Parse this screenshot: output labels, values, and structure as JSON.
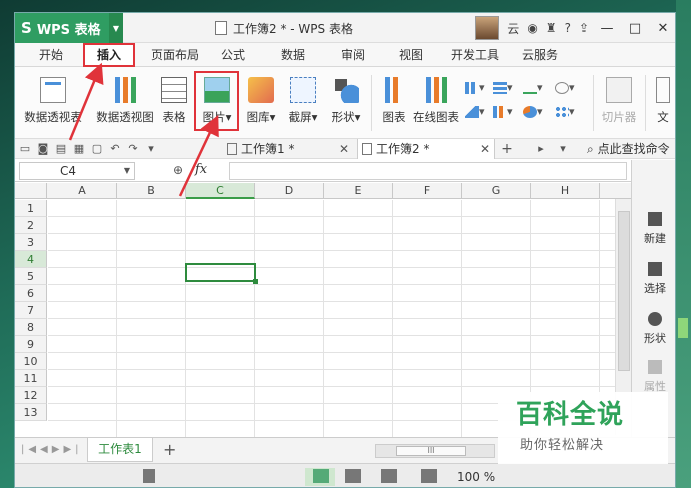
{
  "app": {
    "name": "WPS 表格",
    "doc_title": "工作簿2 * - WPS 表格",
    "user_initial": "云"
  },
  "window_controls": [
    "—",
    "□",
    "✕"
  ],
  "menu": [
    "开始",
    "插入",
    "页面布局",
    "公式",
    "数据",
    "审阅",
    "视图",
    "开发工具",
    "云服务"
  ],
  "active_menu": "插入",
  "ribbon": {
    "pivot_table": "数据透视表",
    "pivot_chart": "数据透视图",
    "table": "表格",
    "picture": "图片",
    "gallery": "图库",
    "screenshot": "截屏",
    "shape": "形状",
    "chart": "图表",
    "online_chart": "在线图表",
    "slicer": "切片器",
    "text": "文"
  },
  "doc_tabs": [
    {
      "label": "工作簿1 *"
    },
    {
      "label": "工作簿2 *"
    }
  ],
  "find_label": "点此查找命令",
  "formula_bar": {
    "name_box": "C4",
    "fx": "fx",
    "value": ""
  },
  "columns": [
    "A",
    "B",
    "C",
    "D",
    "E",
    "F",
    "G",
    "H"
  ],
  "rows": [
    "1",
    "2",
    "3",
    "4",
    "5",
    "6",
    "7",
    "8",
    "9",
    "10",
    "11",
    "12",
    "13"
  ],
  "selected_cell": "C4",
  "task_pane": {
    "new": "新建",
    "select": "选择",
    "shape": "形状",
    "property": "属性"
  },
  "sheet_tab": "工作表1",
  "add_sheet": "+",
  "hscroll_thumb": "III",
  "zoom_label": "100 %",
  "watermark": {
    "top": "百科全说",
    "bottom": "助你轻松解决"
  },
  "colors": {
    "accent_green": "#2f9d62",
    "highlight_red": "#e0333a",
    "selection_green": "#2e8b3e"
  }
}
